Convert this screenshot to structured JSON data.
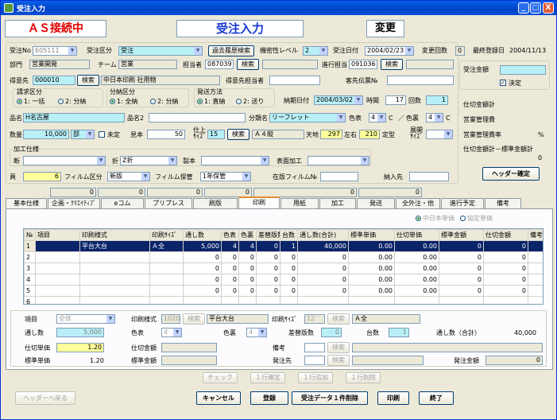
{
  "window": {
    "title": "受注入力",
    "min": "_",
    "max": "□",
    "close": "X"
  },
  "header": {
    "status": "ＡＳ接続中",
    "title": "受注入力",
    "mode": "変更"
  },
  "row1": {
    "order_no_label": "受注No",
    "order_no": "605111",
    "order_type_label": "受注区分",
    "order_type": "受注",
    "history_btn": "過去履歴検索",
    "secrecy_label": "機密性レベル",
    "secrecy": "2",
    "order_date_label": "受注日付",
    "order_date": "2004/02/23",
    "change_count_label": "変更回数",
    "change_count": "0",
    "last_reg_label": "最終登録日",
    "last_reg": "2004/11/13"
  },
  "row2": {
    "dept_label": "部門",
    "dept": "営業開発",
    "team_label": "チーム",
    "team": "営業",
    "person_label": "担当者",
    "person_code": "087039",
    "search": "検索",
    "progress_label": "進行担当",
    "progress_code": "091036"
  },
  "row3": {
    "customer_label": "得意先",
    "customer_code": "000010",
    "search": "検索",
    "customer_name": "中日本印刷 社用物",
    "cust_person_label": "得意先担当者",
    "cust_slip_label": "客先伝票№"
  },
  "billing": {
    "label": "請求区分",
    "opt1": "1: 一括",
    "opt2": "2: 分納"
  },
  "delivery_split": {
    "label": "分納区分",
    "opt1": "1: 全納",
    "opt2": "2: 分納"
  },
  "shipping": {
    "label": "発送方法",
    "opt1": "1: 直納",
    "opt2": "2: 送り"
  },
  "due": {
    "date_label": "納期日付",
    "date": "2004/03/02",
    "time_label": "時間",
    "time": "17",
    "count_label": "回数",
    "count": "1"
  },
  "product": {
    "name_label": "品名",
    "name": "H名古屋",
    "name2_label": "品名2",
    "class_label": "分類名",
    "class": "リーフレット",
    "color_label": "色表",
    "color_front": "4",
    "c1": "C",
    "color_back_label": "色裏",
    "color_back": "4",
    "c2": "C"
  },
  "qty": {
    "label": "数量",
    "value": "10,000",
    "unit": "部",
    "undecided_label": "未定",
    "sample_label": "見本",
    "sample": "50",
    "finish_label": "仕上\nｻｲｽﾞ",
    "finish_code": "15",
    "search": "検索",
    "finish_name": "Ａ４縦",
    "top_bottom_label": "天地",
    "top_bottom": "297",
    "left_right_label": "左右",
    "left_right": "210",
    "fixed_label": "定型",
    "expand_label": "展開\nｻｲｽﾞ"
  },
  "processing": {
    "label": "加工仕様",
    "cut_label": "断",
    "fold_label": "折",
    "fold": "Z折",
    "binding_label": "製本",
    "surface_label": "表面加工"
  },
  "pages": {
    "label": "頁",
    "value": "6",
    "film_label": "フィルム区分",
    "film": "新版",
    "keep_label": "フィルム保管",
    "keep": "1年保管",
    "stock_label": "在版フィルム№",
    "delivery_to_label": "納入先"
  },
  "right_panel": {
    "amount_label": "受注金額",
    "decided_label": "決定",
    "cost_label": "仕切金額計",
    "mgmt_label": "営業管理費",
    "mgmt_rate_label": "営業管理費率",
    "pct": "%",
    "diff_label": "仕切金額計－標準金額計",
    "diff": "0",
    "header_btn": "ヘッダー確定"
  },
  "sumrow": [
    "0",
    "0",
    "0",
    "0",
    "0",
    "0"
  ],
  "tabs": [
    "基本仕様",
    "企画・ｸﾘｴｲﾃｨﾌﾞ",
    "eコム",
    "プリプレス",
    "刷版",
    "印刷",
    "用紙",
    "加工",
    "発送",
    "全外注・他",
    "進行予定",
    "備考"
  ],
  "tab_active": 5,
  "price_radio": {
    "opt1": "中日本単価",
    "opt2": "協定単価"
  },
  "grid": {
    "headers": [
      "№",
      "項目",
      "印刷様式",
      "印刷ｻｲｽﾞ",
      "通し数",
      "色表",
      "色裏",
      "差替版数",
      "台数",
      "通し数(合計)",
      "標準単価",
      "仕切単価",
      "標準金額",
      "仕切金額",
      "備考"
    ],
    "rows": [
      [
        "1",
        "",
        "平台大台",
        "Ａ全",
        "5,000",
        "4",
        "4",
        "0",
        "1",
        "40,000",
        "0.00",
        "0.00",
        "0",
        "0",
        ""
      ],
      [
        "2",
        "",
        "",
        "",
        "0",
        "0",
        "0",
        "0",
        "0",
        "0",
        "0.00",
        "0.00",
        "0",
        "0",
        ""
      ],
      [
        "3",
        "",
        "",
        "",
        "0",
        "0",
        "0",
        "0",
        "0",
        "0",
        "0.00",
        "0.00",
        "0",
        "0",
        ""
      ],
      [
        "4",
        "",
        "",
        "",
        "0",
        "0",
        "0",
        "0",
        "0",
        "0",
        "0.00",
        "0.00",
        "0",
        "0",
        ""
      ],
      [
        "5",
        "",
        "",
        "",
        "0",
        "0",
        "0",
        "0",
        "0",
        "0",
        "0.00",
        "0.00",
        "0",
        "0",
        ""
      ],
      [
        "6",
        "",
        "",
        "",
        "",
        "",
        "",
        "",
        "",
        "",
        "",
        "",
        "",
        "",
        ""
      ]
    ]
  },
  "detail": {
    "item_label": "項目",
    "item": "全体",
    "style_label": "印刷様式",
    "style_code": "1020",
    "search": "検索",
    "style_name": "平台大台",
    "size_label": "印刷ｻｲｽﾞ",
    "size_code": "12",
    "size_name": "Ａ全",
    "pass_label": "通し数",
    "pass": "5,000",
    "front_label": "色表",
    "front": "4",
    "back_label": "色裏",
    "back": "4",
    "swap_label": "差替版数",
    "swap": "0",
    "units_label": "台数",
    "units": "1",
    "total_label": "通し数（合計）",
    "total": "40,000",
    "cost_unit_label": "仕切単価",
    "cost_unit": "1.20",
    "cost_amt_label": "仕切金額",
    "note_label": "備考",
    "std_unit_label": "標準単価",
    "std_unit": "1.20",
    "std_amt_label": "標準金額",
    "sender_label": "発注先",
    "order_amt_label": "発注金額",
    "order_amt": "0"
  },
  "row_buttons": {
    "check": "チェック",
    "confirm": "１行確定",
    "add": "１行追加",
    "delete": "１行削除"
  },
  "footer": {
    "back": "ヘッダーへ戻る",
    "cancel": "キャンセル",
    "register": "登録",
    "delete_order": "受注データ１件削除",
    "print": "印刷",
    "end": "終了"
  }
}
